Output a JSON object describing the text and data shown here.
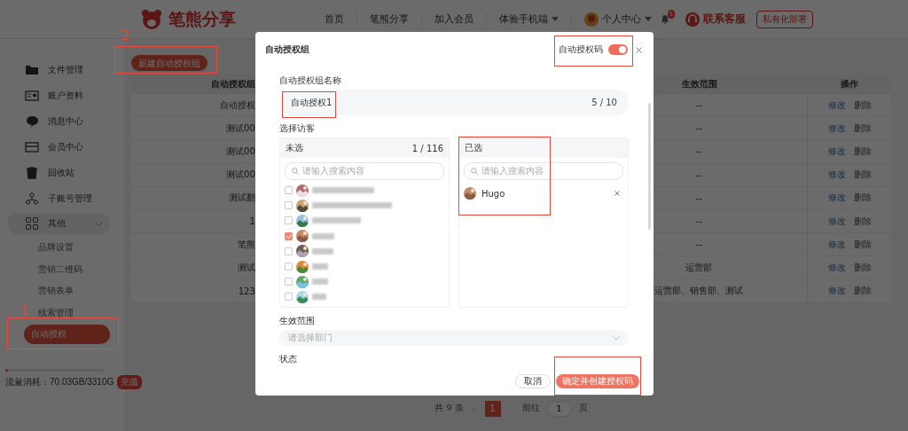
{
  "header": {
    "logo": "笔熊分享",
    "nav": [
      {
        "label": "首页",
        "dropdown": false
      },
      {
        "label": "笔熊分享",
        "dropdown": false
      },
      {
        "label": "加入会员",
        "dropdown": false
      },
      {
        "label": "体验手机端",
        "dropdown": true
      }
    ],
    "user": {
      "label": "个人中心",
      "notifications": "5"
    },
    "support": "联系客服",
    "deploy": "私有化部署"
  },
  "sidebar": {
    "items": [
      {
        "label": "文件管理",
        "selected": false
      },
      {
        "label": "账户资料",
        "selected": false
      },
      {
        "label": "消息中心",
        "selected": false
      },
      {
        "label": "会员中心",
        "selected": false
      },
      {
        "label": "回收站",
        "selected": false
      },
      {
        "label": "子账号管理",
        "selected": false
      },
      {
        "label": "其他",
        "selected": false,
        "expanded": true,
        "children": [
          {
            "label": "品牌设置",
            "selected": false
          },
          {
            "label": "营销二维码",
            "selected": false
          },
          {
            "label": "营销表单",
            "selected": false
          },
          {
            "label": "线索管理",
            "selected": false
          },
          {
            "label": "自动授权",
            "selected": true
          }
        ]
      }
    ],
    "usage": {
      "label": "流量消耗：70.03GB/3310G",
      "level": 0.02,
      "button": "充值"
    }
  },
  "toolbar": {
    "new_button": "新建自动授权组"
  },
  "table": {
    "columns": [
      {
        "label": "自动授权组"
      },
      {
        "label": "生效范围"
      },
      {
        "label": "操作"
      }
    ],
    "rows": [
      {
        "name": "自动授权",
        "scope": "--",
        "actions": [
          "修改",
          "删除"
        ]
      },
      {
        "name": "测试00",
        "scope": "--",
        "actions": [
          "修改",
          "删除"
        ]
      },
      {
        "name": "测试00",
        "scope": "--",
        "actions": [
          "修改",
          "删除"
        ]
      },
      {
        "name": "测试00",
        "scope": "--",
        "actions": [
          "修改",
          "删除"
        ]
      },
      {
        "name": "测试翻",
        "scope": "--",
        "actions": [
          "修改",
          "删除"
        ]
      },
      {
        "name": "1",
        "scope": "--",
        "actions": [
          "修改",
          "删除"
        ]
      },
      {
        "name": "笔熊",
        "scope": "--",
        "actions": [
          "修改",
          "删除"
        ]
      },
      {
        "name": "测试",
        "scope": "运营部",
        "actions": [
          "修改",
          "删除"
        ]
      },
      {
        "name": "123",
        "scope": "运营部、销售部、测试",
        "actions": [
          "修改",
          "删除"
        ]
      }
    ]
  },
  "pagination": {
    "total": "共 9 条",
    "pages": [
      {
        "label": "1",
        "selected": true
      }
    ],
    "goto": "前往",
    "goto_value": "1",
    "unit": "页"
  },
  "dialog": {
    "title": "自动授权组",
    "toggle": {
      "label": "自动授权码",
      "on": true
    },
    "name_field": {
      "label": "自动授权组名称",
      "value": "自动授权1",
      "counter": "5 / 10"
    },
    "visitors": {
      "label": "选择访客",
      "source": {
        "title": "未选",
        "count": "1 / 116",
        "search_placeholder": "请输入搜索内容",
        "items": [
          {
            "checked": false
          },
          {
            "checked": false
          },
          {
            "checked": false
          },
          {
            "checked": true
          },
          {
            "checked": false
          },
          {
            "checked": false
          },
          {
            "checked": false
          },
          {
            "checked": false
          }
        ]
      },
      "target": {
        "title": "已选",
        "search_placeholder": "请输入搜索内容",
        "items": [
          {
            "name": "Hugo"
          }
        ]
      }
    },
    "scope": {
      "label": "生效范围",
      "placeholder": "请选择部门"
    },
    "status": {
      "label": "状态"
    },
    "buttons": [
      {
        "label": "取消",
        "kind": "secondary"
      },
      {
        "label": "确定并创建授权码",
        "kind": "primary"
      }
    ]
  },
  "annotations": [
    {
      "label": "1"
    },
    {
      "label": "2"
    }
  ]
}
